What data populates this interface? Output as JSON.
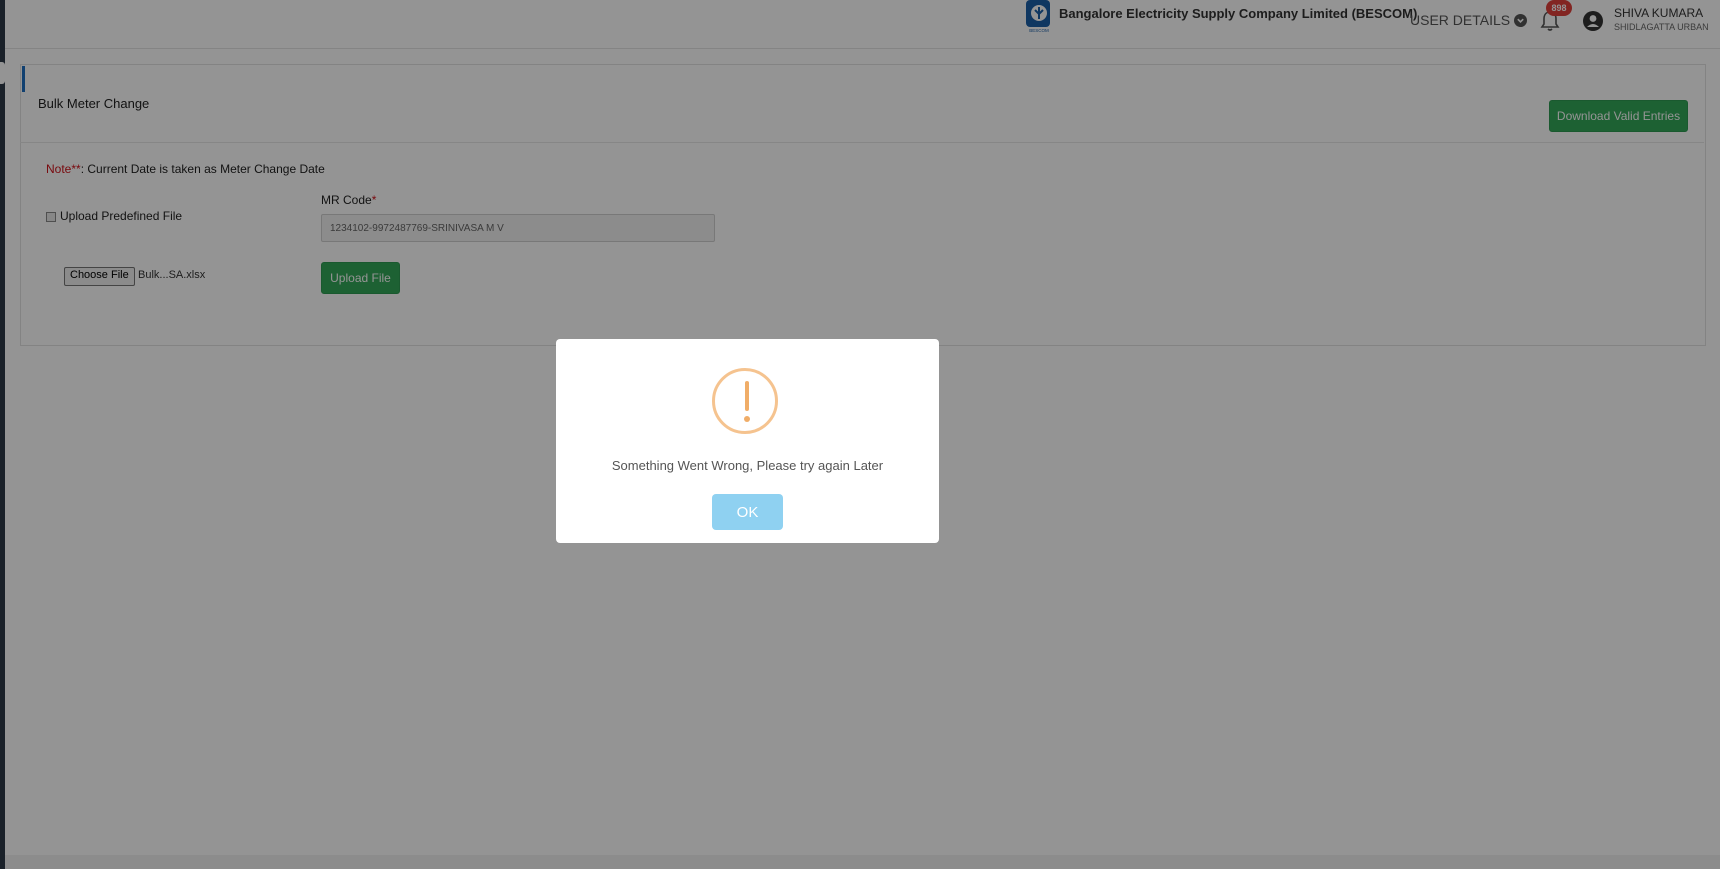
{
  "header": {
    "company_name": "Bangalore Electricity Supply Company Limited (BESCOM)",
    "logo_caption": "BESCOM",
    "user_details_label": "USER DETAILS",
    "notification_count": "898",
    "user": {
      "name": "SHIVA KUMARA",
      "location": "SHIDLAGATTA URBAN"
    }
  },
  "page": {
    "title": "Bulk Meter Change",
    "download_button": "Download Valid Entries",
    "note_prefix": "Note**",
    "note_text": ": Current Date is taken as Meter Change Date",
    "upload_predefined_label": "Upload Predefined File",
    "upload_predefined_checked": false,
    "mr_code_label": "MR Code",
    "mr_code_required_mark": "*",
    "mr_code_value": "1234102-9972487769-SRINIVASA M V",
    "choose_file_label": "Choose File",
    "file_name": "Bulk...SA.xlsx",
    "upload_button": "Upload File"
  },
  "dialog": {
    "icon": "warning-icon",
    "message": "Something Went Wrong, Please try again Later",
    "ok_label": "OK"
  },
  "colors": {
    "primary_green": "#33a859",
    "accent_blue": "#1e6fc2",
    "warning_orange": "#f0ad68",
    "ok_button": "#8fd1f1",
    "badge_red": "#e0403c"
  }
}
